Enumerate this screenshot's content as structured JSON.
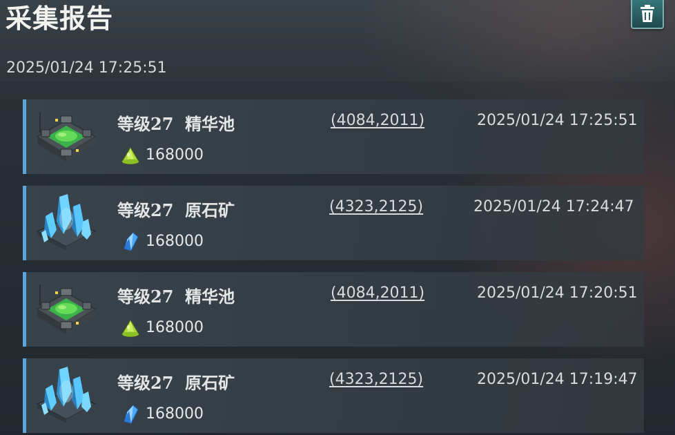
{
  "header": {
    "title": "采集报告",
    "datetime": "2025/01/24  17:25:51",
    "delete_icon": "trash-icon"
  },
  "reports": [
    {
      "level_name": "等级27  精华池",
      "coords": "(4084,2011)",
      "time": "2025/01/24 17:25:51",
      "amount": "168000",
      "building": "essence-pool",
      "resource_icon": "essence-icon"
    },
    {
      "level_name": "等级27  原石矿",
      "coords": "(4323,2125)",
      "time": "2025/01/24 17:24:47",
      "amount": "168000",
      "building": "crystal-mine",
      "resource_icon": "crystal-icon"
    },
    {
      "level_name": "等级27  精华池",
      "coords": "(4084,2011)",
      "time": "2025/01/24 17:20:51",
      "amount": "168000",
      "building": "essence-pool",
      "resource_icon": "essence-icon"
    },
    {
      "level_name": "等级27  原石矿",
      "coords": "(4323,2125)",
      "time": "2025/01/24 17:19:47",
      "amount": "168000",
      "building": "crystal-mine",
      "resource_icon": "crystal-icon"
    }
  ],
  "colors": {
    "accent_bar": "#5aa6dc",
    "title_text": "#f2f2ef",
    "delete_button": "#2a5e62"
  }
}
